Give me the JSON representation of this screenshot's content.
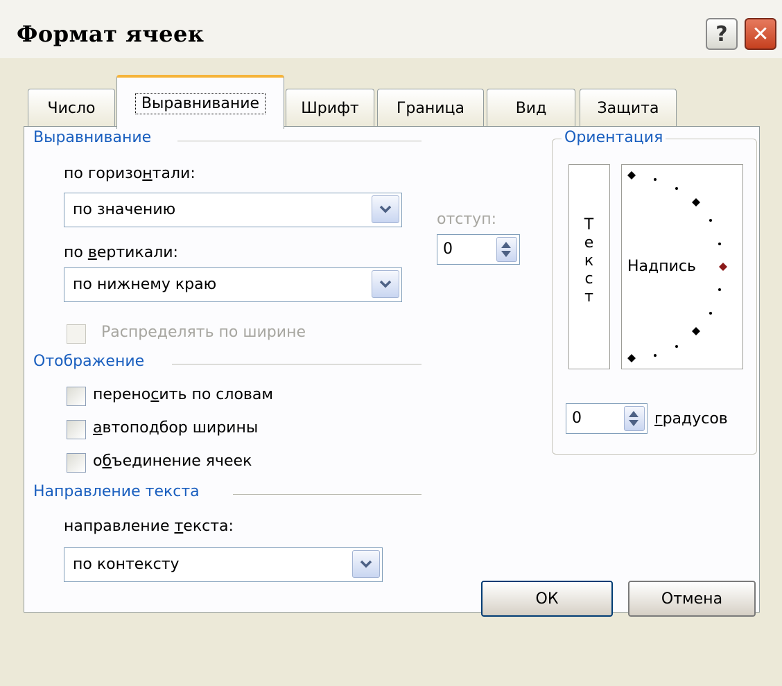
{
  "window": {
    "title": "Формат ячеек",
    "help_label": "?",
    "close_label": "✕"
  },
  "tabs": [
    {
      "label": "Число",
      "active": false
    },
    {
      "label": "Выравнивание",
      "active": true
    },
    {
      "label": "Шрифт",
      "active": false
    },
    {
      "label": "Граница",
      "active": false
    },
    {
      "label": "Вид",
      "active": false
    },
    {
      "label": "Защита",
      "active": false
    }
  ],
  "alignment": {
    "group_label": "Выравнивание",
    "horizontal": {
      "label_pre": "по горизо",
      "label_mn": "н",
      "label_post": "тали:",
      "value": "по значению"
    },
    "vertical": {
      "label_pre": "по ",
      "label_mn": "в",
      "label_post": "ертикали:",
      "value": "по нижнему краю"
    },
    "indent": {
      "label": "отступ:",
      "value": "0"
    },
    "distribute": {
      "label": "Распределять по ширине",
      "checked": false,
      "enabled": false
    }
  },
  "display": {
    "group_label": "Отображение",
    "wrap": {
      "label_pre": "перено",
      "label_mn": "с",
      "label_post": "ить по словам",
      "checked": false
    },
    "shrink": {
      "label_pre": "",
      "label_mn": "а",
      "label_post": "втоподбор ширины",
      "checked": false
    },
    "merge": {
      "label_pre": "о",
      "label_mn": "б",
      "label_post": "ъединение ячеек",
      "checked": false
    }
  },
  "direction": {
    "group_label": "Направление текста",
    "label_pre": "направление ",
    "label_mn": "т",
    "label_post": "екста:",
    "value": "по контексту"
  },
  "orientation": {
    "group_label": "Ориентация",
    "vertical_text": "Текст",
    "dial_label": "Надпись",
    "degrees_value": "0",
    "degrees_label_mn": "г",
    "degrees_label_post": "радусов"
  },
  "buttons": {
    "ok": "ОК",
    "cancel": "Отмена"
  },
  "colors": {
    "accent": "#1a5fbf",
    "tab_highlight": "#f5b43a",
    "close": "#c5401f",
    "dial_marker": "#8b1a1a"
  }
}
